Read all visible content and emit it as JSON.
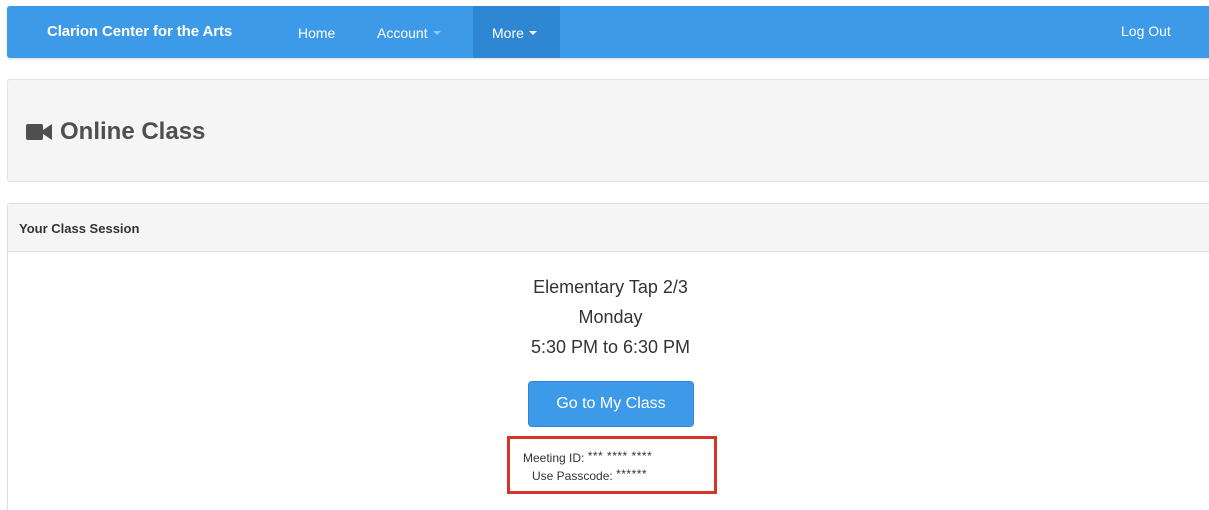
{
  "navbar": {
    "brand": "Clarion Center for the Arts",
    "home_label": "Home",
    "account_label": "Account",
    "more_label": "More",
    "logout_label": "Log Out",
    "color": "#3d9ae8"
  },
  "page": {
    "title_icon": "video-camera-icon",
    "title": "Online Class"
  },
  "panel": {
    "heading": "Your Class Session",
    "class_name": "Elementary Tap 2/3",
    "day": "Monday",
    "time": "5:30 PM to 6:30 PM",
    "button_label": "Go to My Class",
    "meeting_id_label": "Meeting ID:",
    "meeting_id_value": "*** **** ****",
    "passcode_label": "Use Passcode:",
    "passcode_value": "******",
    "highlight_color": "#d4362a"
  }
}
